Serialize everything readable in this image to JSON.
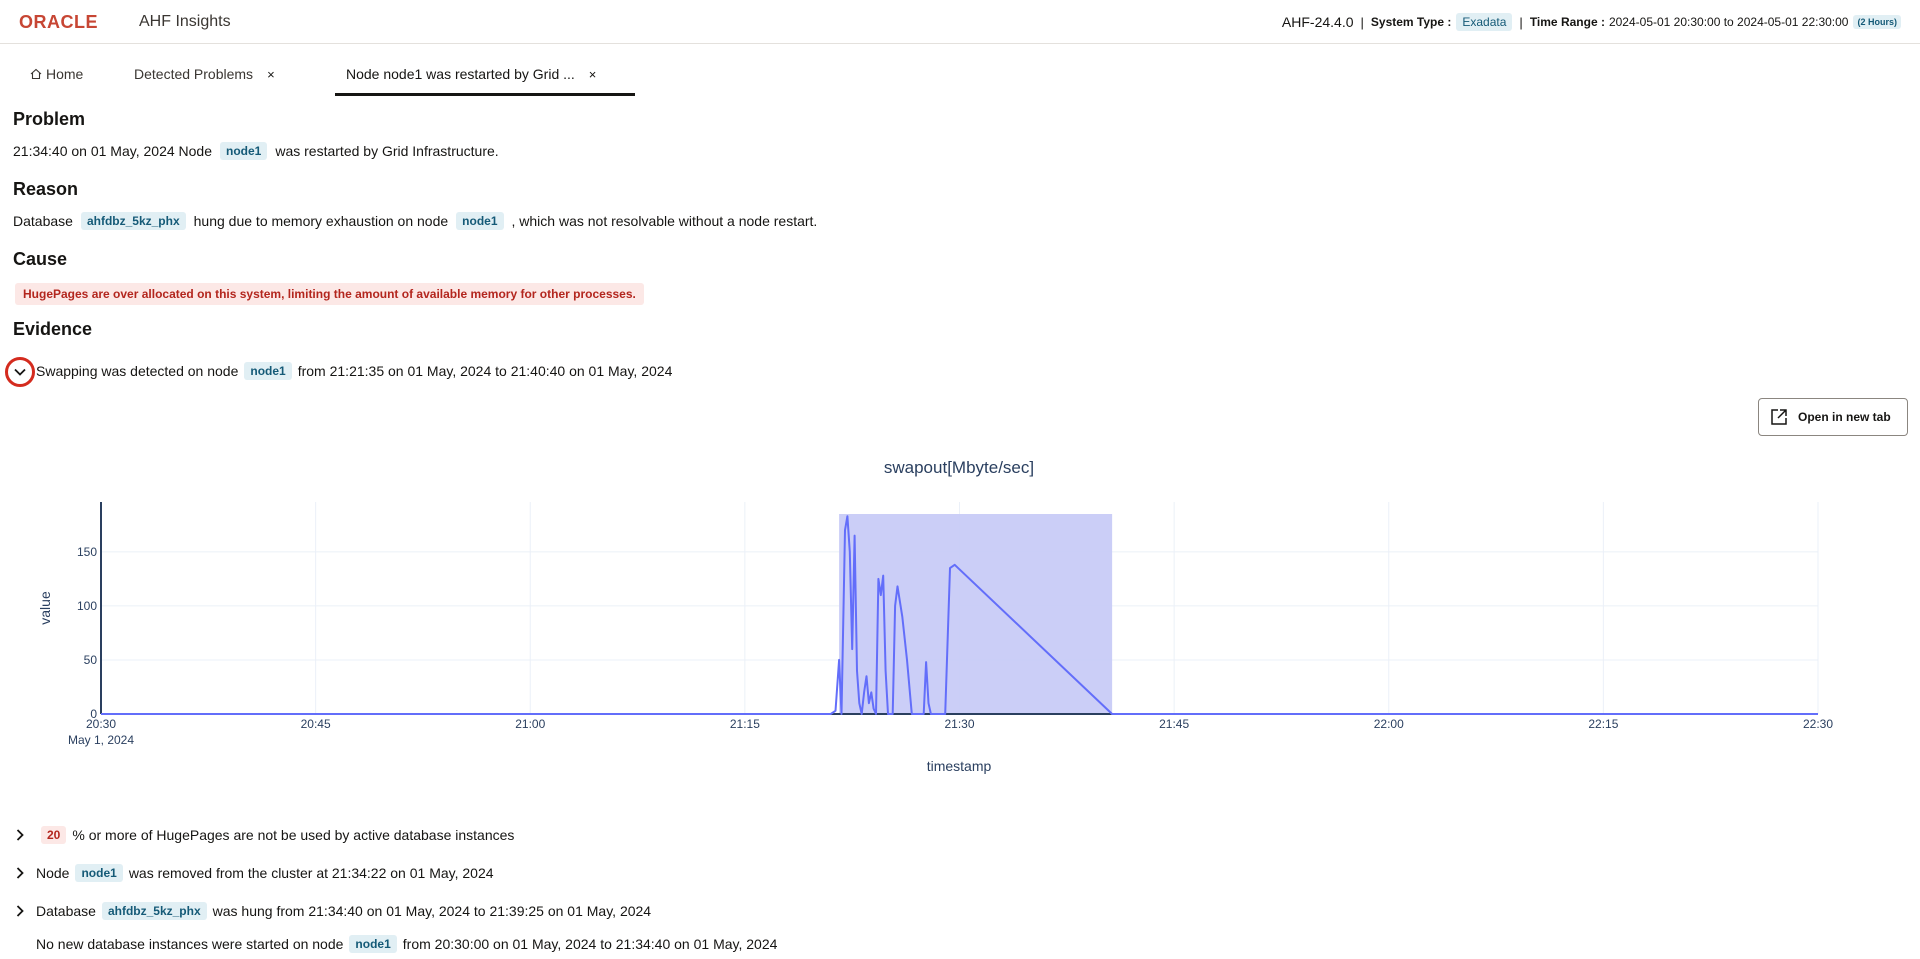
{
  "header": {
    "brand": "ORACLE",
    "product": "AHF Insights",
    "version": "AHF-24.4.0",
    "system_type_label": "System Type :",
    "system_type": "Exadata",
    "time_range_label": "Time Range :",
    "time_range": "2024-05-01 20:30:00 to 2024-05-01 22:30:00",
    "duration": "(2 Hours)"
  },
  "tabs": [
    {
      "label": "Home",
      "icon": "home-icon"
    },
    {
      "label": "Detected Problems",
      "close": "×"
    },
    {
      "label": "Node node1 was restarted by Grid ...",
      "close": "×",
      "active": true
    }
  ],
  "problem": {
    "title": "Problem",
    "prefix": "21:34:40 on 01 May, 2024 Node",
    "node": "node1",
    "suffix": "was restarted by Grid Infrastructure."
  },
  "reason": {
    "title": "Reason",
    "prefix": "Database",
    "db": "ahfdbz_5kz_phx",
    "middle": "hung due to memory exhaustion on node",
    "node": "node1",
    "suffix": ", which was not resolvable without a node restart."
  },
  "cause": {
    "title": "Cause",
    "text": "HugePages are over allocated on this system, limiting the amount of available memory for other processes."
  },
  "evidence": {
    "title": "Evidence",
    "open_button": "Open in new tab",
    "items": [
      {
        "prefix": "Swapping was detected on node",
        "chip": "node1",
        "suffix": "from 21:21:35 on 01 May, 2024 to 21:40:40 on 01 May, 2024",
        "expanded": true
      },
      {
        "chip": "20",
        "suffix": "% or more of HugePages are not be used by active database instances"
      },
      {
        "prefix": "Node",
        "chip": "node1",
        "suffix": "was removed from the cluster at 21:34:22 on 01 May, 2024"
      },
      {
        "prefix": "Database",
        "chip": "ahfdbz_5kz_phx",
        "suffix": "was hung from 21:34:40 on 01 May, 2024 to 21:39:25 on 01 May, 2024"
      },
      {
        "prefix": "No new database instances were started on node",
        "chip": "node1",
        "suffix": "from 20:30:00 on 01 May, 2024 to 21:34:40 on 01 May, 2024"
      }
    ]
  },
  "colors": {
    "accent": "#636efa",
    "highlight": "#c8cbf7",
    "brand_red": "#c74634",
    "chip_bg": "#e1eff4",
    "chip_fg": "#155a77"
  },
  "chart_data": {
    "type": "line",
    "title": "swapout[Mbyte/sec]",
    "xlabel": "timestamp",
    "ylabel": "value",
    "x_ticks": [
      "20:30",
      "20:45",
      "21:00",
      "21:15",
      "21:30",
      "21:45",
      "22:00",
      "22:15",
      "22:30"
    ],
    "x_sublabel": "May 1, 2024",
    "y_ticks": [
      0,
      50,
      100,
      150
    ],
    "ylim": [
      0,
      185
    ],
    "xlim": [
      "20:30",
      "22:30"
    ],
    "grid": true,
    "highlight_range": [
      "21:21:35",
      "21:40:40"
    ],
    "series": [
      {
        "x": [
          "20:30",
          "21:21",
          "21:21:20",
          "21:21:35",
          "21:21:45",
          "21:22:00",
          "21:22:10",
          "21:22:20",
          "21:22:30",
          "21:22:40",
          "21:22:50",
          "21:23:00",
          "21:23:10",
          "21:23:20",
          "21:23:30",
          "21:23:40",
          "21:23:50",
          "21:24:00",
          "21:24:10",
          "21:24:20",
          "21:24:30",
          "21:24:40",
          "21:24:50",
          "21:25:00",
          "21:25:10",
          "21:25:20",
          "21:25:30",
          "21:25:40",
          "21:26:00",
          "21:26:20",
          "21:26:40",
          "21:27:00",
          "21:27:30",
          "21:27:40",
          "21:27:50",
          "21:28:00",
          "21:28:10",
          "21:28:20",
          "21:29",
          "21:29:20",
          "21:29:40",
          "21:40:40",
          "22:30"
        ],
        "y": [
          0,
          0,
          3,
          50,
          0,
          170,
          183,
          150,
          60,
          165,
          40,
          10,
          0,
          20,
          35,
          10,
          20,
          5,
          0,
          125,
          110,
          128,
          40,
          0,
          0,
          0,
          100,
          118,
          90,
          50,
          0,
          0,
          0,
          48,
          10,
          0,
          0,
          0,
          0,
          135,
          138,
          0,
          0
        ]
      }
    ]
  }
}
